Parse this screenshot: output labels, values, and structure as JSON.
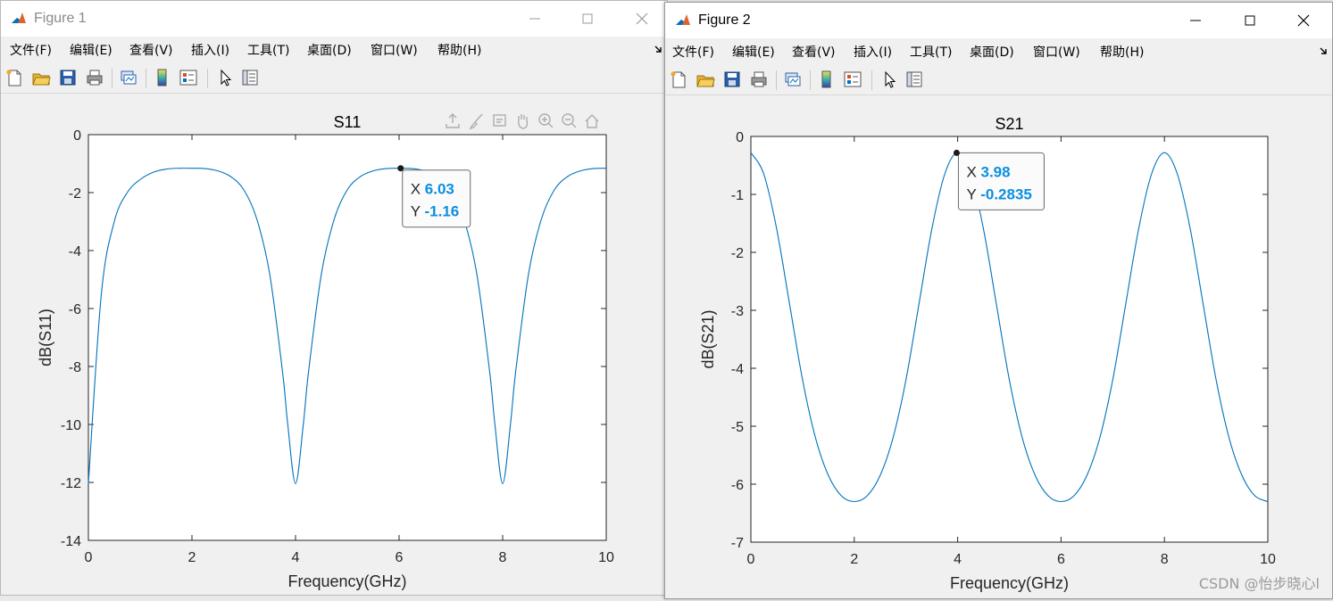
{
  "window1": {
    "title": "Figure 1",
    "menu": [
      "文件(F)",
      "编辑(E)",
      "查看(V)",
      "插入(I)",
      "工具(T)",
      "桌面(D)",
      "窗口(W)",
      "帮助(H)"
    ]
  },
  "window2": {
    "title": "Figure 2",
    "menu": [
      "文件(F)",
      "编辑(E)",
      "查看(V)",
      "插入(I)",
      "工具(T)",
      "桌面(D)",
      "窗口(W)",
      "帮助(H)"
    ]
  },
  "toolbar_icons": [
    "new-figure-icon",
    "open-file-icon",
    "save-icon",
    "print-icon",
    "link-plot-icon",
    "insert-colorbar-icon",
    "insert-legend-icon",
    "pointer-icon",
    "property-inspector-icon"
  ],
  "axes_toolbar_icons": [
    "export-icon",
    "brush-icon",
    "data-tips-icon",
    "pan-icon",
    "zoom-in-icon",
    "zoom-out-icon",
    "home-icon"
  ],
  "colors": {
    "line": "#0072bd",
    "datatip_value": "#0b8fe0"
  },
  "chart_data": [
    {
      "type": "line",
      "title": "S11",
      "xlabel": "Frequency(GHz)",
      "ylabel": "dB(S11)",
      "xlim": [
        0,
        10
      ],
      "ylim": [
        -14,
        0
      ],
      "xticks": [
        0,
        2,
        4,
        6,
        8,
        10
      ],
      "yticks": [
        0,
        -2,
        -4,
        -6,
        -8,
        -10,
        -12,
        -14
      ],
      "grid": false,
      "series": [
        {
          "x": [
            0,
            0.25,
            0.5,
            0.75,
            1,
            1.25,
            1.5,
            1.75,
            2,
            2.25,
            2.5,
            2.75,
            3,
            3.25,
            3.5,
            3.75,
            3.85,
            4,
            4.15,
            4.25,
            4.5,
            4.75,
            5,
            5.25,
            5.5,
            5.75,
            6,
            6.25,
            6.5,
            6.75,
            7,
            7.25,
            7.5,
            7.75,
            7.85,
            8,
            8.15,
            8.25,
            8.5,
            8.75,
            9,
            9.25,
            9.5,
            9.75,
            10
          ],
          "y": [
            -12.04,
            -5.5,
            -3.0,
            -2.0,
            -1.55,
            -1.3,
            -1.19,
            -1.16,
            -1.16,
            -1.17,
            -1.25,
            -1.45,
            -1.9,
            -2.9,
            -4.8,
            -8.2,
            -10.0,
            -12.04,
            -10.0,
            -8.2,
            -4.8,
            -2.9,
            -1.9,
            -1.45,
            -1.25,
            -1.17,
            -1.16,
            -1.17,
            -1.25,
            -1.45,
            -1.9,
            -2.9,
            -4.8,
            -8.2,
            -10.0,
            -12.04,
            -10.0,
            -8.2,
            -4.8,
            -2.9,
            -1.9,
            -1.45,
            -1.25,
            -1.17,
            -1.16
          ]
        }
      ],
      "datatip": {
        "x": 6.03,
        "y": -1.16,
        "x_label": "X",
        "y_label": "Y",
        "x_text": "6.03",
        "y_text": "-1.16"
      }
    },
    {
      "type": "line",
      "title": "S21",
      "xlabel": "Frequency(GHz)",
      "ylabel": "dB(S21)",
      "xlim": [
        0,
        10
      ],
      "ylim": [
        -7,
        0
      ],
      "xticks": [
        0,
        2,
        4,
        6,
        8,
        10
      ],
      "yticks": [
        0,
        -1,
        -2,
        -3,
        -4,
        -5,
        -6,
        -7
      ],
      "grid": false,
      "series": [
        {
          "x": [
            0,
            0.25,
            0.5,
            0.75,
            1,
            1.25,
            1.5,
            1.75,
            2,
            2.25,
            2.5,
            2.75,
            3,
            3.25,
            3.5,
            3.75,
            4,
            4.25,
            4.5,
            4.75,
            5,
            5.25,
            5.5,
            5.75,
            6,
            6.25,
            6.5,
            6.75,
            7,
            7.25,
            7.5,
            7.75,
            8,
            8.25,
            8.5,
            8.75,
            9,
            9.25,
            9.5,
            9.75,
            10
          ],
          "y": [
            -0.28,
            -0.65,
            -1.6,
            -2.9,
            -4.2,
            -5.2,
            -5.85,
            -6.2,
            -6.3,
            -6.2,
            -5.85,
            -5.2,
            -4.2,
            -2.9,
            -1.6,
            -0.65,
            -0.28,
            -0.65,
            -1.6,
            -2.9,
            -4.2,
            -5.2,
            -5.85,
            -6.2,
            -6.3,
            -6.2,
            -5.85,
            -5.2,
            -4.2,
            -2.9,
            -1.6,
            -0.65,
            -0.28,
            -0.65,
            -1.6,
            -2.9,
            -4.2,
            -5.2,
            -5.85,
            -6.2,
            -6.3
          ]
        }
      ],
      "datatip": {
        "x": 3.98,
        "y": -0.2835,
        "x_label": "X",
        "y_label": "Y",
        "x_text": "3.98",
        "y_text": "-0.2835"
      }
    }
  ],
  "watermark": "CSDN @怡步晓心l"
}
